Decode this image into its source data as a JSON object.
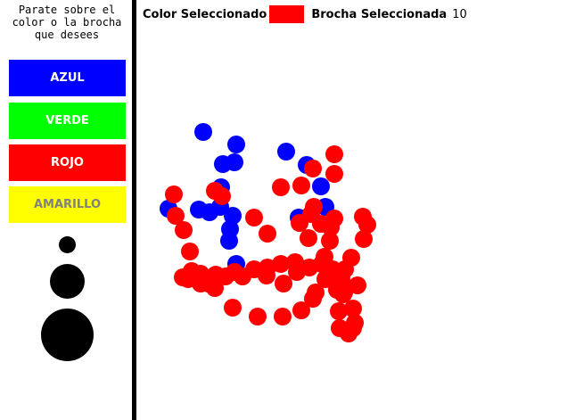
{
  "sidebar": {
    "instructions": "Parate sobre el\ncolor o la brocha\nque desees",
    "colors": [
      {
        "label": "AZUL",
        "bg": "#0000ff",
        "fg": "#ffffff"
      },
      {
        "label": "VERDE",
        "bg": "#00ff00",
        "fg": "#ffffff"
      },
      {
        "label": "ROJO",
        "bg": "#ff0000",
        "fg": "#ffffff"
      },
      {
        "label": "AMARILLO",
        "bg": "#ffff00",
        "fg": "#808080"
      }
    ],
    "brushes": [
      "small",
      "medium",
      "large"
    ]
  },
  "topbar": {
    "color_label": "Color Seleccionado",
    "selected_color": "#ff0000",
    "brush_label": "Brocha Seleccionada",
    "brush_size": "10"
  },
  "strokes": {
    "blue": "#0000ff",
    "red": "#ff0000"
  }
}
